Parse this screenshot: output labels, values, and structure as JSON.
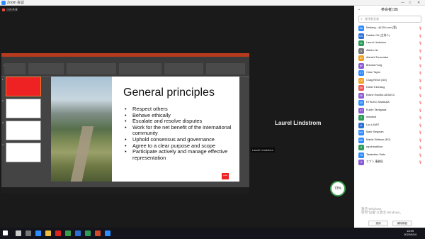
{
  "window": {
    "title": "Zoom 会议"
  },
  "meeting": {
    "sharing_label": "正在共享",
    "speaker_name": "Laurel Lindstrom",
    "video_label": "Laurel Lindstrom",
    "zoom_percent": "73%"
  },
  "slide": {
    "title": "General principles",
    "bullets": [
      "Respect others",
      "Behave ethically",
      "Escalate and resolve disputes",
      "Work for the net benefit of the international community",
      "Uphold consensus and governance",
      "Agree to a clear purpose and scope",
      "Participate actively and manage effective representation"
    ],
    "logo_text": "ICANN"
  },
  "panel": {
    "title": "参会者(18)",
    "search_placeholder": "查找参会者",
    "participants": [
      {
        "initials": "Me",
        "name": "Meifang…@126.com (我)",
        "color": "#2d8cff"
      },
      {
        "initials": "DO",
        "name": "Dabbie Orf (主持人)",
        "color": "#2b6fd6"
      },
      {
        "initials": "LL",
        "name": "Laurel Lindstrom",
        "color": "#2e9b5a"
      },
      {
        "initials": "A",
        "name": "Akihiro Iio",
        "color": "#777"
      },
      {
        "initials": "AT",
        "name": "Atsushi Tomonaka",
        "color": "#f0a020"
      },
      {
        "initials": "BF",
        "name": "Brenda Fang",
        "color": "#8a5bd6"
      },
      {
        "initials": "CT",
        "name": "Clare Taylor",
        "color": "#2d8cff"
      },
      {
        "initials": "CR",
        "name": "Craig Reinir (GE)",
        "color": "#f0a020"
      },
      {
        "initials": "DK",
        "name": "Dieter Kleefang",
        "color": "#e55"
      },
      {
        "initials": "EE",
        "name": "Elaine Ewolfor-AEA/ICC",
        "color": "#8a5bd6"
      },
      {
        "initials": "ES",
        "name": "ETSUKO SAWADA",
        "color": "#2d8cff"
      },
      {
        "initials": "KT",
        "name": "Kuichi Tamigawa",
        "color": "#8a5bd6"
      },
      {
        "initials": "S",
        "name": "lsmidind",
        "color": "#2e9b5a"
      },
      {
        "initials": "LL",
        "name": "Luc LAMIT",
        "color": "#2b6fd6"
      },
      {
        "initials": "MS",
        "name": "Mark Siegman",
        "color": "#2d8cff"
      },
      {
        "initials": "ME",
        "name": "Martin Elsfeum (EG)",
        "color": "#2d8cff"
      },
      {
        "initials": "R",
        "name": "rapcheysBoor",
        "color": "#2e9b5a"
      },
      {
        "initials": "TS",
        "name": "Tadamitsu Saito",
        "color": "#2d8cff"
      },
      {
        "initials": "エ",
        "name": "エブン 事務局",
        "color": "#8a5bd6"
      }
    ],
    "watermark_line1": "激活 Windows",
    "watermark_line2": "转到\"设置\"以激活 Windows。",
    "invite_label": "邀请",
    "mute_all_label": "解除静音"
  },
  "taskbar": {
    "time": "16:09",
    "date": "2022/5/24"
  },
  "colors": {
    "zoom_blue": "#2d8cff",
    "ppt_red": "#b83b1e",
    "accent_green": "#3a9e4c"
  }
}
